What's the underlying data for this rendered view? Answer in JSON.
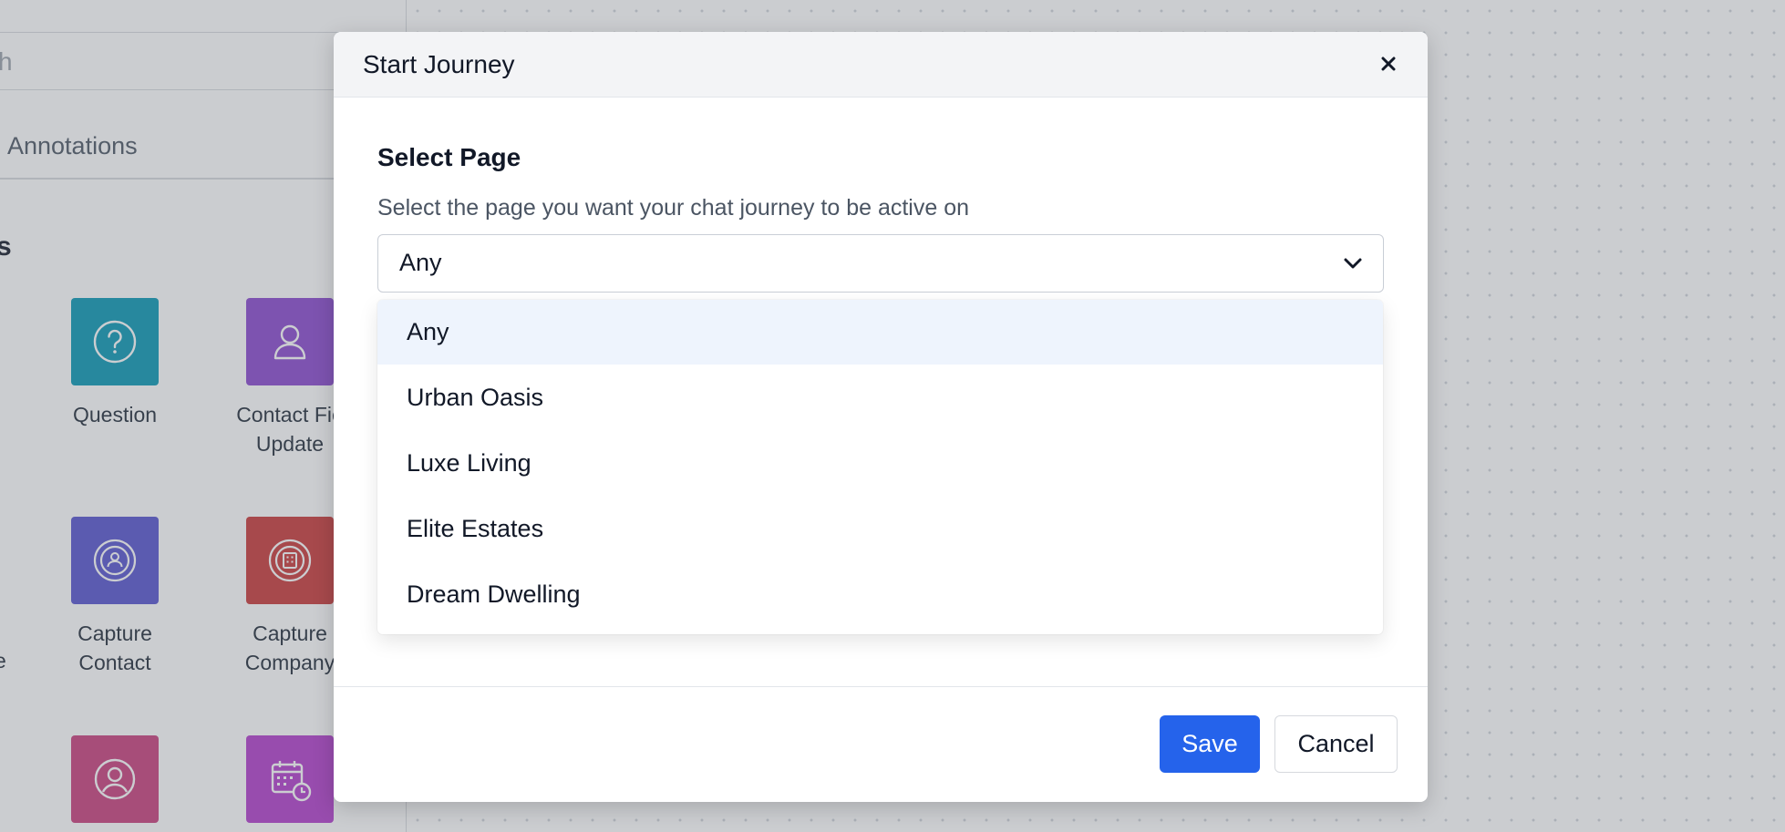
{
  "sidebar": {
    "search_placeholder_fragment": "h",
    "tab_label": "Annotations",
    "section_title_fragment": "s",
    "tiles": [
      {
        "label": "Question",
        "color": "#0797b4",
        "icon": "question-circle-icon"
      },
      {
        "label": "Contact Fie\nUpdate",
        "color": "#8947cf",
        "icon": "user-icon"
      },
      {
        "label": "Capture\nContact",
        "color": "#5552cf",
        "icon": "capture-contact-icon"
      },
      {
        "label": "Capture\nCompany",
        "color": "#c93838",
        "icon": "capture-company-icon"
      },
      {
        "label": "",
        "color": "#c93d7c",
        "icon": "user-circle-icon"
      },
      {
        "label": "",
        "color": "#b23ccc",
        "icon": "calendar-clock-icon"
      }
    ],
    "edge_fragment": "e"
  },
  "modal": {
    "title": "Start Journey",
    "close_icon": "close-icon",
    "field_label": "Select Page",
    "field_help": "Select the page you want your chat journey to be active on",
    "selected_value": "Any",
    "options": [
      "Any",
      "Urban Oasis",
      "Luxe Living",
      "Elite Estates",
      "Dream Dwelling"
    ],
    "save_label": "Save",
    "cancel_label": "Cancel"
  },
  "colors": {
    "primary": "#2563eb",
    "option_highlight": "#eef4fd"
  }
}
